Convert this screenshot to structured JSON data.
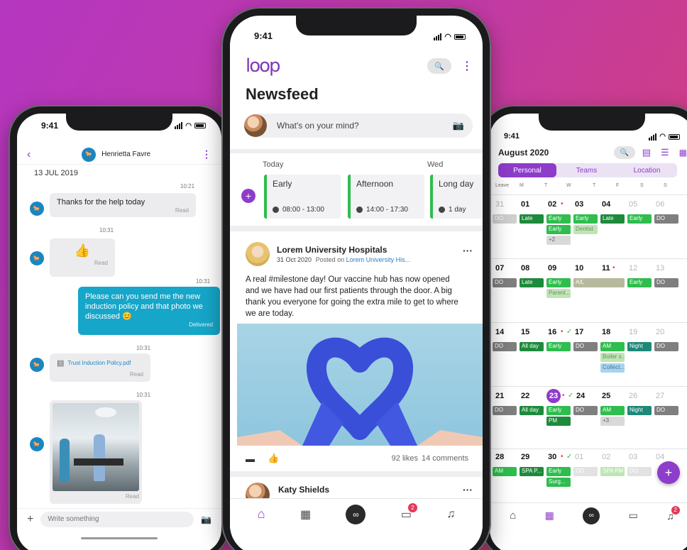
{
  "left_phone": {
    "status_time": "9:41",
    "contact_name": "Henrietta Favre",
    "date_header": "13 JUL 2019",
    "messages": [
      {
        "time": "10:21",
        "text": "Thanks for the help today",
        "status": "Read"
      },
      {
        "time": "10:31",
        "text": "👍",
        "status": "Read"
      },
      {
        "time": "10:31",
        "text": "Please can you send me the new induction policy and that photo we discussed 😊",
        "status": "Delivered"
      },
      {
        "time": "10:31",
        "text": "Trust Induction Policy.pdf",
        "status": "Read"
      },
      {
        "time": "10:31",
        "text": "",
        "status": "Read"
      }
    ],
    "input_placeholder": "Write something"
  },
  "center_phone": {
    "status_time": "9:41",
    "logo": "loop",
    "page_title": "Newsfeed",
    "composer_placeholder": "What's on your mind?",
    "schedule": {
      "today_label": "Today",
      "wed_label": "Wed",
      "shifts": [
        {
          "name": "Early",
          "time": "08:00 - 13:00"
        },
        {
          "name": "Afternoon",
          "time": "14:00 - 17:30"
        },
        {
          "name": "Long day",
          "time": "1 day"
        }
      ]
    },
    "post": {
      "author": "Lorem University Hospitals",
      "date": "31 Oct 2020",
      "posted_on_label": "Posted on",
      "posted_on_link": "Lorem University His...",
      "body": "A real #milestone day! Our vaccine hub has now opened and we have had our first patients through the door. A big thank you everyone for going the extra mile to get to where we are today.",
      "likes": "92 likes",
      "comments": "14 comments"
    },
    "next_post_author": "Katy Shields",
    "nav_badge": "2"
  },
  "right_phone": {
    "status_time": "9:41",
    "month": "August 2020",
    "tabs": [
      "Personal",
      "Teams",
      "Location"
    ],
    "weekday_headers": [
      "Leave",
      "M",
      "T",
      "W",
      "T",
      "F",
      "S",
      "S"
    ],
    "weeks": [
      {
        "days": [
          "31",
          "01",
          "02",
          "03",
          "04",
          "05",
          "06"
        ]
      },
      {
        "days": [
          "07",
          "08",
          "09",
          "10",
          "11",
          "12",
          "13"
        ]
      },
      {
        "days": [
          "14",
          "15",
          "16",
          "17",
          "18",
          "19",
          "20"
        ]
      },
      {
        "days": [
          "21",
          "22",
          "23",
          "24",
          "25",
          "26",
          "27"
        ]
      },
      {
        "days": [
          "28",
          "29",
          "30",
          "01",
          "02",
          "03",
          "04"
        ]
      }
    ],
    "chips": {
      "do": "DO",
      "late": "Late",
      "early": "Early",
      "dentist": "Dentist",
      "plus2": "+2",
      "parent": "Parent...",
      "al": "A/L",
      "allday": "All day",
      "am": "AM",
      "night": "Night",
      "boiler": "Boiler s...",
      "collect": "Collect...",
      "pm": "PM",
      "plus3": "+3",
      "spa": "SPA P...",
      "surg": "Surg...",
      "spapm": "SPA PM"
    },
    "nav_badge": "2"
  }
}
